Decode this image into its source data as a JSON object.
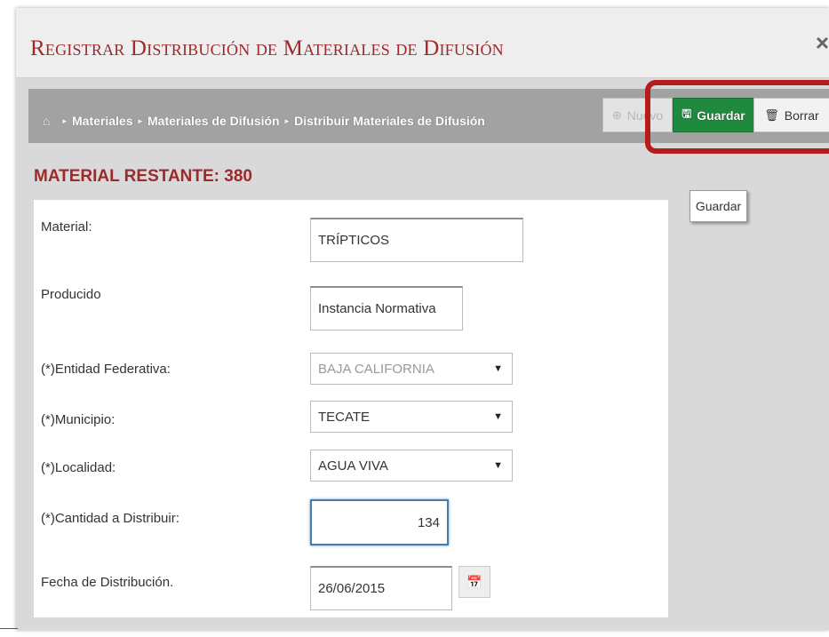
{
  "dialog": {
    "title": "Registrar Distribución de Materiales de Difusión",
    "close_icon": "×"
  },
  "breadcrumb": {
    "home_icon": "⌂",
    "items": [
      "Materiales",
      "Materiales de Difusión",
      "Distribuir Materiales de Difusión"
    ],
    "separator": "▸"
  },
  "toolbar": {
    "nuevo_icon": "⊕",
    "nuevo_label": "Nuevo",
    "guardar_icon": "🖫",
    "guardar_label": "Guardar",
    "borrar_icon": "🗑",
    "borrar_label": "Borrar"
  },
  "tooltip": {
    "text": "Guardar"
  },
  "remaining": {
    "text": "MATERIAL RESTANTE: 380"
  },
  "form": {
    "material_label": "Material:",
    "material_value": "TRÍPTICOS",
    "producido_label": "Producido",
    "producido_value": "Instancia Normativa",
    "entidad_label": "(*)Entidad Federativa:",
    "entidad_value": "BAJA CALIFORNIA",
    "municipio_label": "(*)Municipio:",
    "municipio_value": "TECATE",
    "localidad_label": "(*)Localidad:",
    "localidad_value": "AGUA VIVA",
    "cantidad_label": "(*)Cantidad a Distribuir:",
    "cantidad_value": "134",
    "fecha_label": "Fecha de Distribución.",
    "fecha_value": "26/06/2015",
    "select_arrow": "▼",
    "calendar_icon": "📅"
  },
  "colors": {
    "title": "#9c2a2a",
    "guardar_bg": "#1f8a3d",
    "highlight": "#b71c1c",
    "toolbar_bg": "#a2a2a2"
  }
}
